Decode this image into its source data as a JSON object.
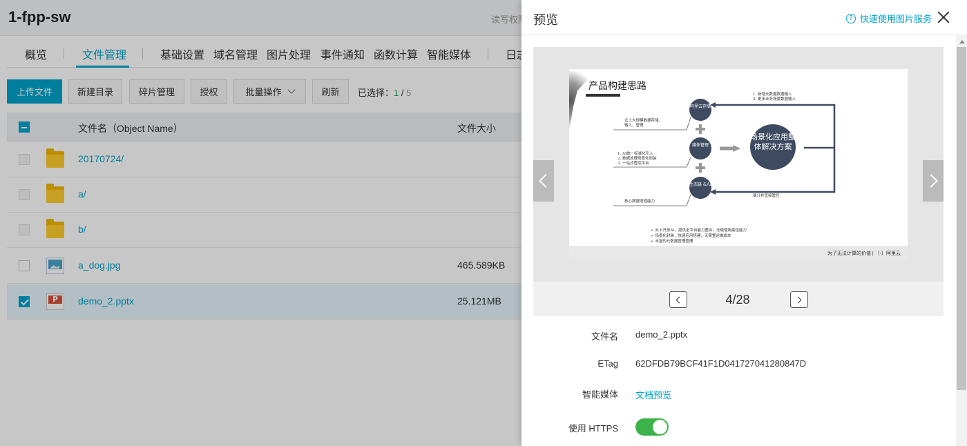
{
  "bucket": {
    "title": "1-fpp-sw",
    "acl_tag": "读写权限"
  },
  "tabs": [
    {
      "label": "概览"
    },
    {
      "label": "文件管理",
      "active": true
    },
    {
      "label": "基础设置"
    },
    {
      "label": "域名管理"
    },
    {
      "label": "图片处理"
    },
    {
      "label": "事件通知"
    },
    {
      "label": "函数计算"
    },
    {
      "label": "智能媒体"
    },
    {
      "label": "日志"
    }
  ],
  "toolbar": {
    "upload": "上传文件",
    "new_dir": "新建目录",
    "fragments": "碎片管理",
    "authorize": "授权",
    "batch": "批量操作",
    "refresh": "刷新",
    "selected_label": "已选择：",
    "selected_count": "1",
    "selected_sep": " / ",
    "total_count": "5"
  },
  "table": {
    "col_name": "文件名（Object Name）",
    "col_size": "文件大小",
    "rows": [
      {
        "name": "20170724/",
        "type": "folder",
        "size": ""
      },
      {
        "name": "a/",
        "type": "folder",
        "size": ""
      },
      {
        "name": "b/",
        "type": "folder",
        "size": ""
      },
      {
        "name": "a_dog.jpg",
        "type": "image",
        "size": "465.589KB"
      },
      {
        "name": "demo_2.pptx",
        "type": "pptx",
        "size": "25.121MB",
        "selected": true
      }
    ]
  },
  "preview": {
    "title": "预览",
    "help_link": "快速使用图片服务",
    "help_icon": "?",
    "slide": {
      "title": "产品构建思路",
      "node_storage": "阿里云存储",
      "node_media": "媒体管理",
      "node_ai": "生态链 &AI",
      "node_center": "场景化应用整体解决方案",
      "text_top_right_1": "1. 新增元数据数据输入",
      "text_top_right_2": "2. 更多业务场景数据输入",
      "text_left_1a": "云上大规模数据存储、",
      "text_left_1b": "输入、管理",
      "text_left_2a": "1. AI统一标准化引入",
      "text_left_2b": "2. 数据处理场景化封装",
      "text_left_2c": "3. 一站式管控平台",
      "text_left_3": "核心数据增值能力",
      "text_bottom_right": "细分并直接管控",
      "bullet_1": "云上开放AI，提供全平台能力整合，无缝使用最佳能力",
      "bullet_2": "场景化封装，快速应用搭建，无需置运维成本",
      "bullet_3": "丰富的元数据管理管理",
      "footer": "为了无法计算的价值 | 〔-〕阿里云"
    },
    "page_indicator": "4/28",
    "meta": {
      "filename_label": "文件名",
      "filename_value": "demo_2.pptx",
      "etag_label": "ETag",
      "etag_value": "62DFDB79BCF41F1D041727041280847D",
      "media_label": "智能媒体",
      "media_value": "文档预览",
      "https_label": "使用 HTTPS",
      "https_on": true
    }
  },
  "colors": {
    "accent": "#00a2ca",
    "toggle_on": "#3bb34a",
    "selected_count": "#2a9a5a"
  }
}
